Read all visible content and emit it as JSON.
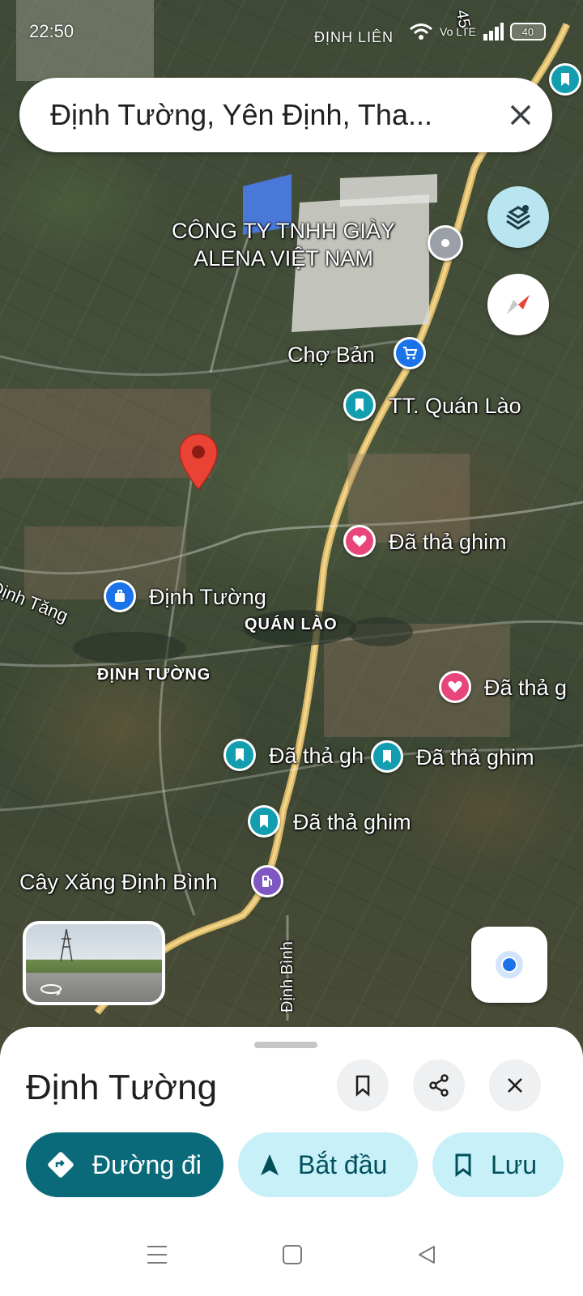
{
  "status_bar": {
    "time": "22:50",
    "carrier": "ĐỊNH LIÊN",
    "lte": "Vo LTE",
    "battery": "40"
  },
  "search": {
    "query": "Định Tường, Yên Định, Tha..."
  },
  "map_labels": {
    "company_line1": "CÔNG TY TNHH GIÀY",
    "company_line2": "ALENA VIỆT NAM",
    "cho_ban": "Chợ Bản",
    "tt_quan_lao": "TT. Quán Lào",
    "pinned_1": "Đã thả ghim",
    "dinh_tang": "Định Tăng",
    "dinh_tuong_place": "Định Tường",
    "quan_lao_area": "QUÁN LÀO",
    "dinh_tuong_area": "ĐỊNH TƯỜNG",
    "pinned_2": "Đã thả g",
    "pinned_3": "Đã thả gh",
    "pinned_4": "Đã thả ghim",
    "pinned_5": "Đã thả ghim",
    "gas_station": "Cây Xăng Định Bình",
    "road_dinh_binh": "Định Bình",
    "road_45": "45"
  },
  "sheet": {
    "title": "Định Tường",
    "directions_label": "Đường đi",
    "start_label": "Bắt đầu",
    "save_label": "Lưu"
  },
  "colors": {
    "primary": "#0b6a7a",
    "light_button": "#c7f0f8",
    "pin_red": "#ea4335",
    "teal_pin": "#129eaf",
    "pink_pin": "#e8457a"
  }
}
